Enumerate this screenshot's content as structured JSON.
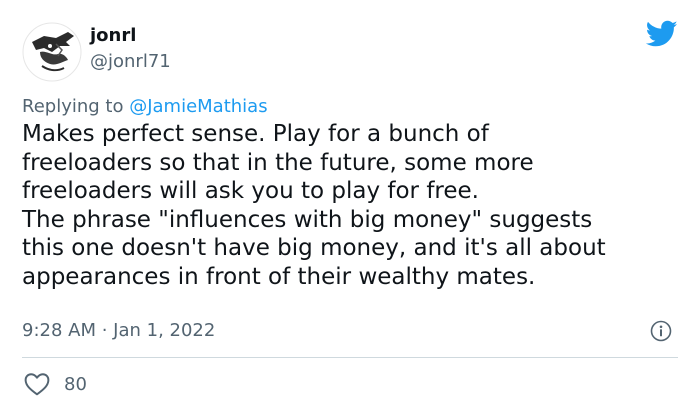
{
  "tweet": {
    "display_name": "jonrl",
    "handle": "@jonrl71",
    "reply_prefix": "Replying to ",
    "reply_to": "@JamieMathias",
    "text_lines": [
      "Makes perfect sense. Play for a bunch of",
      "freeloaders so that in the future, some more",
      "freeloaders will ask you to play for free.",
      "The phrase \"influences with big money\" suggests",
      "this one doesn't have big money, and it's all about",
      "appearances in front of their wealthy mates."
    ],
    "timestamp": "9:28 AM · Jan 1, 2022",
    "likes": "80"
  },
  "icons": {
    "brand": "twitter-bird-icon",
    "info": "info-icon",
    "like": "heart-icon"
  },
  "colors": {
    "brand_blue": "#1d9bf0",
    "text": "#0f1419",
    "secondary": "#536471",
    "divider": "#cfd9de"
  }
}
